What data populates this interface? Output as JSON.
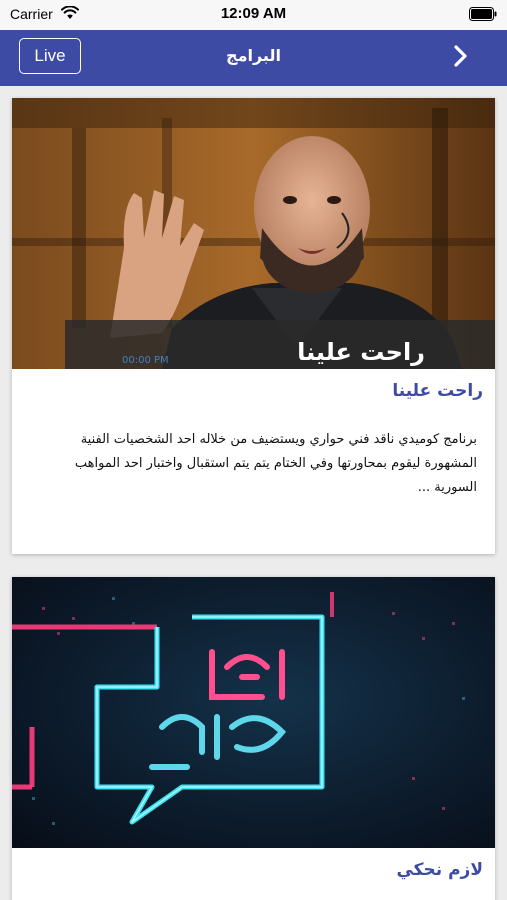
{
  "status_bar": {
    "carrier": "Carrier",
    "time": "12:09 AM"
  },
  "nav": {
    "live_label": "Live",
    "title": "البرامج"
  },
  "programs": [
    {
      "title": "راحت علينا",
      "image_caption": "راحت علينا",
      "description": "برنامج كوميدي ناقد فني حواري ويستضيف من خلاله احد الشخصيات الفنية المشهورة ليقوم بمحاورتها وفي الختام يتم يتم استقبال واختبار احد المواهب السورية ..."
    },
    {
      "title": "لازم نحكي",
      "image_caption": "لازم نحكي",
      "description": ""
    }
  ],
  "colors": {
    "nav_bg": "#3e4ba4",
    "title_color": "#3e4ba4",
    "page_bg": "#ececec"
  }
}
